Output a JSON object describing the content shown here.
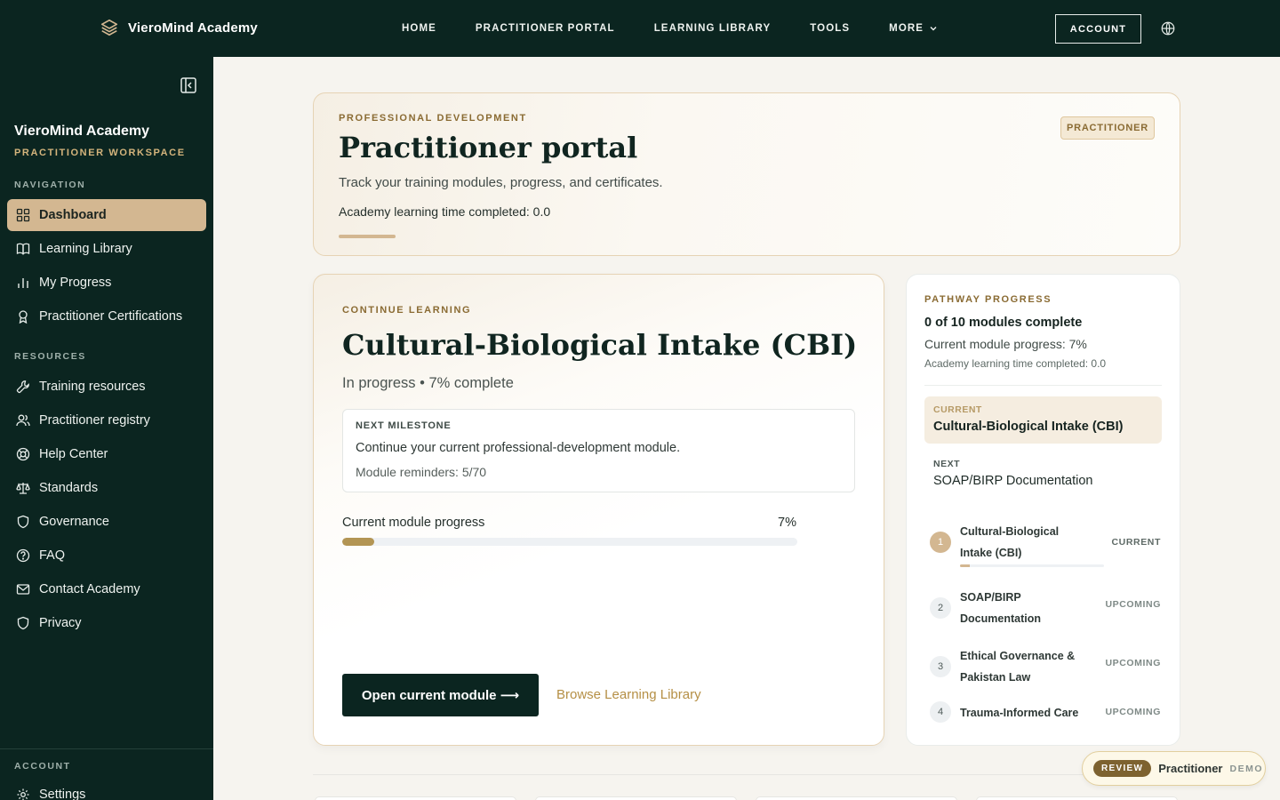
{
  "brand": {
    "name": "VieroMind Academy"
  },
  "nav": {
    "items": [
      "HOME",
      "PRACTITIONER PORTAL",
      "LEARNING LIBRARY",
      "TOOLS",
      "MORE"
    ],
    "account_label": "ACCOUNT"
  },
  "sidebar": {
    "title": "VieroMind Academy",
    "subtitle": "PRACTITIONER WORKSPACE",
    "navigation_heading": "NAVIGATION",
    "navigation": [
      {
        "label": "Dashboard",
        "icon": "dashboard-icon",
        "active": true
      },
      {
        "label": "Learning Library",
        "icon": "book-icon"
      },
      {
        "label": "My Progress",
        "icon": "bar-chart-icon"
      },
      {
        "label": "Practitioner Certifications",
        "icon": "award-icon"
      }
    ],
    "resources_heading": "RESOURCES",
    "resources": [
      {
        "label": "Training resources",
        "icon": "wrench-icon"
      },
      {
        "label": "Practitioner registry",
        "icon": "users-icon"
      },
      {
        "label": "Help Center",
        "icon": "lifebuoy-icon"
      },
      {
        "label": "Standards",
        "icon": "scale-icon"
      },
      {
        "label": "Governance",
        "icon": "shield-icon"
      },
      {
        "label": "FAQ",
        "icon": "question-icon"
      },
      {
        "label": "Contact Academy",
        "icon": "mail-icon"
      },
      {
        "label": "Privacy",
        "icon": "shield-icon"
      }
    ],
    "account_heading": "ACCOUNT",
    "account": [
      {
        "label": "Settings",
        "icon": "gear-icon"
      }
    ]
  },
  "hero": {
    "eyebrow": "PROFESSIONAL DEVELOPMENT",
    "title": "Practitioner portal",
    "description": "Track your training modules, progress, and certificates.",
    "time_completed": "Academy learning time completed: 0.0",
    "badge": "PRACTITIONER"
  },
  "continue": {
    "eyebrow": "CONTINUE LEARNING",
    "title": "Cultural-Biological Intake (CBI)",
    "status": "In progress • 7% complete",
    "milestone_label": "NEXT MILESTONE",
    "milestone_text": "Continue your current professional-development module.",
    "reminders": "Module reminders: 5/70",
    "progress_label": "Current module progress",
    "progress_text": "7%",
    "progress_value": 0.07,
    "open_button": "Open current module ⟶",
    "browse_link": "Browse Learning Library"
  },
  "pathway": {
    "eyebrow": "PATHWAY PROGRESS",
    "count": "0 of 10 modules complete",
    "current_progress": "Current module progress: 7%",
    "time_completed": "Academy learning time completed: 0.0",
    "current_key": "CURRENT",
    "current_value": "Cultural-Biological Intake (CBI)",
    "next_key": "NEXT",
    "next_value": "SOAP/BIRP Documentation",
    "steps": [
      {
        "num": "1",
        "name": "Cultural-Biological Intake (CBI)",
        "state": "CURRENT",
        "progress": 0.07
      },
      {
        "num": "2",
        "name": "SOAP/BIRP Documentation",
        "state": "UPCOMING"
      },
      {
        "num": "3",
        "name": "Ethical Governance & Pakistan Law",
        "state": "UPCOMING"
      },
      {
        "num": "4",
        "name": "Trauma-Informed Care",
        "state": "UPCOMING"
      }
    ]
  },
  "review_pill": {
    "tag": "REVIEW",
    "role": "Practitioner",
    "mode": "DEMO"
  },
  "colors": {
    "primary_dark": "#0b2520",
    "accent_gold": "#d3b791",
    "accent_brown": "#8a6b33"
  }
}
